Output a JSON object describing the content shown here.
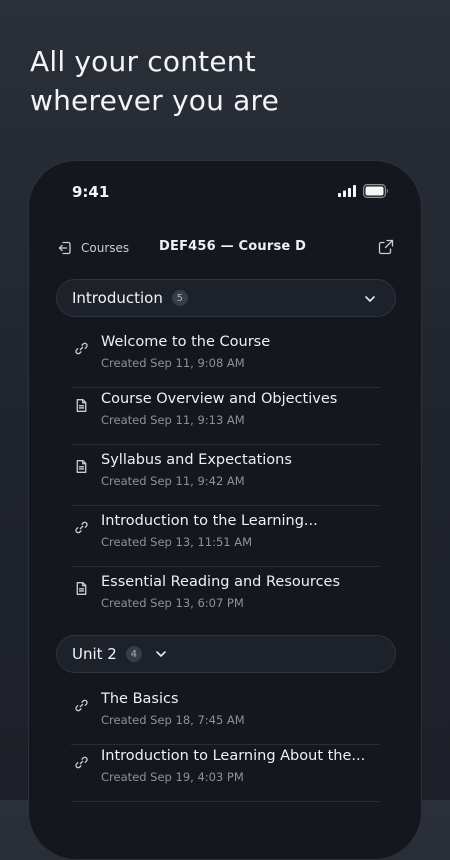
{
  "headline": {
    "line1": "All your content",
    "line2": "wherever you are"
  },
  "status_bar": {
    "time": "9:41"
  },
  "nav": {
    "back_label": "Courses",
    "title": "DEF456 — Course D"
  },
  "sections": [
    {
      "title": "Introduction",
      "count": "5",
      "expanded": true,
      "items": [
        {
          "icon": "link-icon",
          "title": "Welcome to the Course",
          "meta": "Created Sep 11, 9:08 AM"
        },
        {
          "icon": "document-icon",
          "title": "Course Overview and Objectives",
          "meta": "Created Sep 11, 9:13 AM"
        },
        {
          "icon": "document-icon",
          "title": "Syllabus and Expectations",
          "meta": "Created Sep 11, 9:42 AM"
        },
        {
          "icon": "link-icon",
          "title": "Introduction to the Learning...",
          "meta": "Created Sep 13, 11:51 AM"
        },
        {
          "icon": "document-icon",
          "title": "Essential Reading and Resources",
          "meta": "Created Sep 13, 6:07 PM"
        }
      ]
    },
    {
      "title": "Unit 2",
      "count": "4",
      "expanded": true,
      "items": [
        {
          "icon": "link-icon",
          "title": "The Basics",
          "meta": "Created Sep 18, 7:45 AM"
        },
        {
          "icon": "link-icon",
          "title": "Introduction to Learning About the...",
          "meta": "Created Sep 19, 4:03 PM"
        }
      ]
    }
  ],
  "colors": {
    "background": "#23272f",
    "phone": "#14171d",
    "text_primary": "#eef0f4",
    "text_secondary": "#8c929c"
  }
}
